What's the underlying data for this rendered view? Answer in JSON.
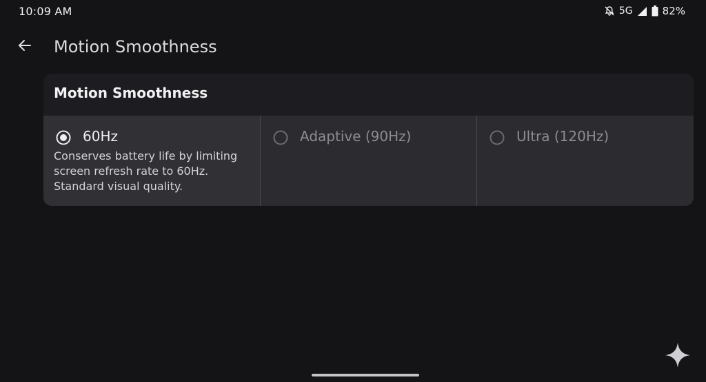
{
  "status_bar": {
    "time": "10:09 AM",
    "network": "5G",
    "battery": "82%",
    "icons": [
      "notifications-off-icon",
      "cellular-signal-icon",
      "battery-icon"
    ]
  },
  "app_bar": {
    "back_icon": "arrow-left-icon",
    "title": "Motion Smoothness"
  },
  "card": {
    "title": "Motion Smoothness",
    "options": [
      {
        "label": "60Hz",
        "selected": true,
        "description": "Conserves battery life by limiting screen refresh rate to 60Hz. Standard visual quality."
      },
      {
        "label": "Adaptive (90Hz)",
        "selected": false
      },
      {
        "label": "Ultra (120Hz)",
        "selected": false
      }
    ]
  },
  "floating_icon": "sparkle-icon",
  "colors": {
    "background": "#141416",
    "card": "#1d1d21",
    "option_selected_bg": "#313135",
    "text_primary": "#f2f2f4",
    "text_disabled": "#8c8c91"
  }
}
